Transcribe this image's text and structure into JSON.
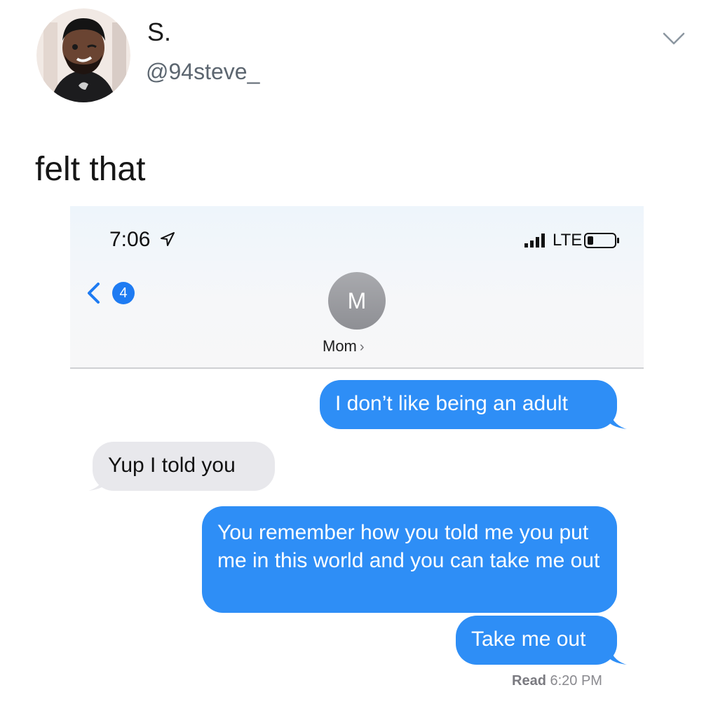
{
  "tweet": {
    "display_name": "S.",
    "handle": "@94steve_",
    "text": "felt that",
    "avatar_icon": "memoji-avatar",
    "menu_icon": "chevron-down-icon"
  },
  "phone": {
    "status_bar": {
      "time": "7:06",
      "network": "LTE"
    },
    "nav": {
      "back_badge": "4",
      "contact_initial": "M",
      "contact_name": "Mom",
      "contact_chevron": "›"
    },
    "messages": [
      {
        "sender": "me",
        "text": "I don’t like being an adult"
      },
      {
        "sender": "them",
        "text": "Yup I told you"
      },
      {
        "sender": "me",
        "text": "You remember how you told me you put me in this world and you can take me out"
      },
      {
        "sender": "me",
        "text": "Take me out"
      }
    ],
    "read_receipt": {
      "label": "Read",
      "time": "6:20 PM"
    }
  },
  "colors": {
    "sent_bubble": "#2e8ef6",
    "received_bubble": "#e8e8ec",
    "badge": "#1e7bf2"
  }
}
